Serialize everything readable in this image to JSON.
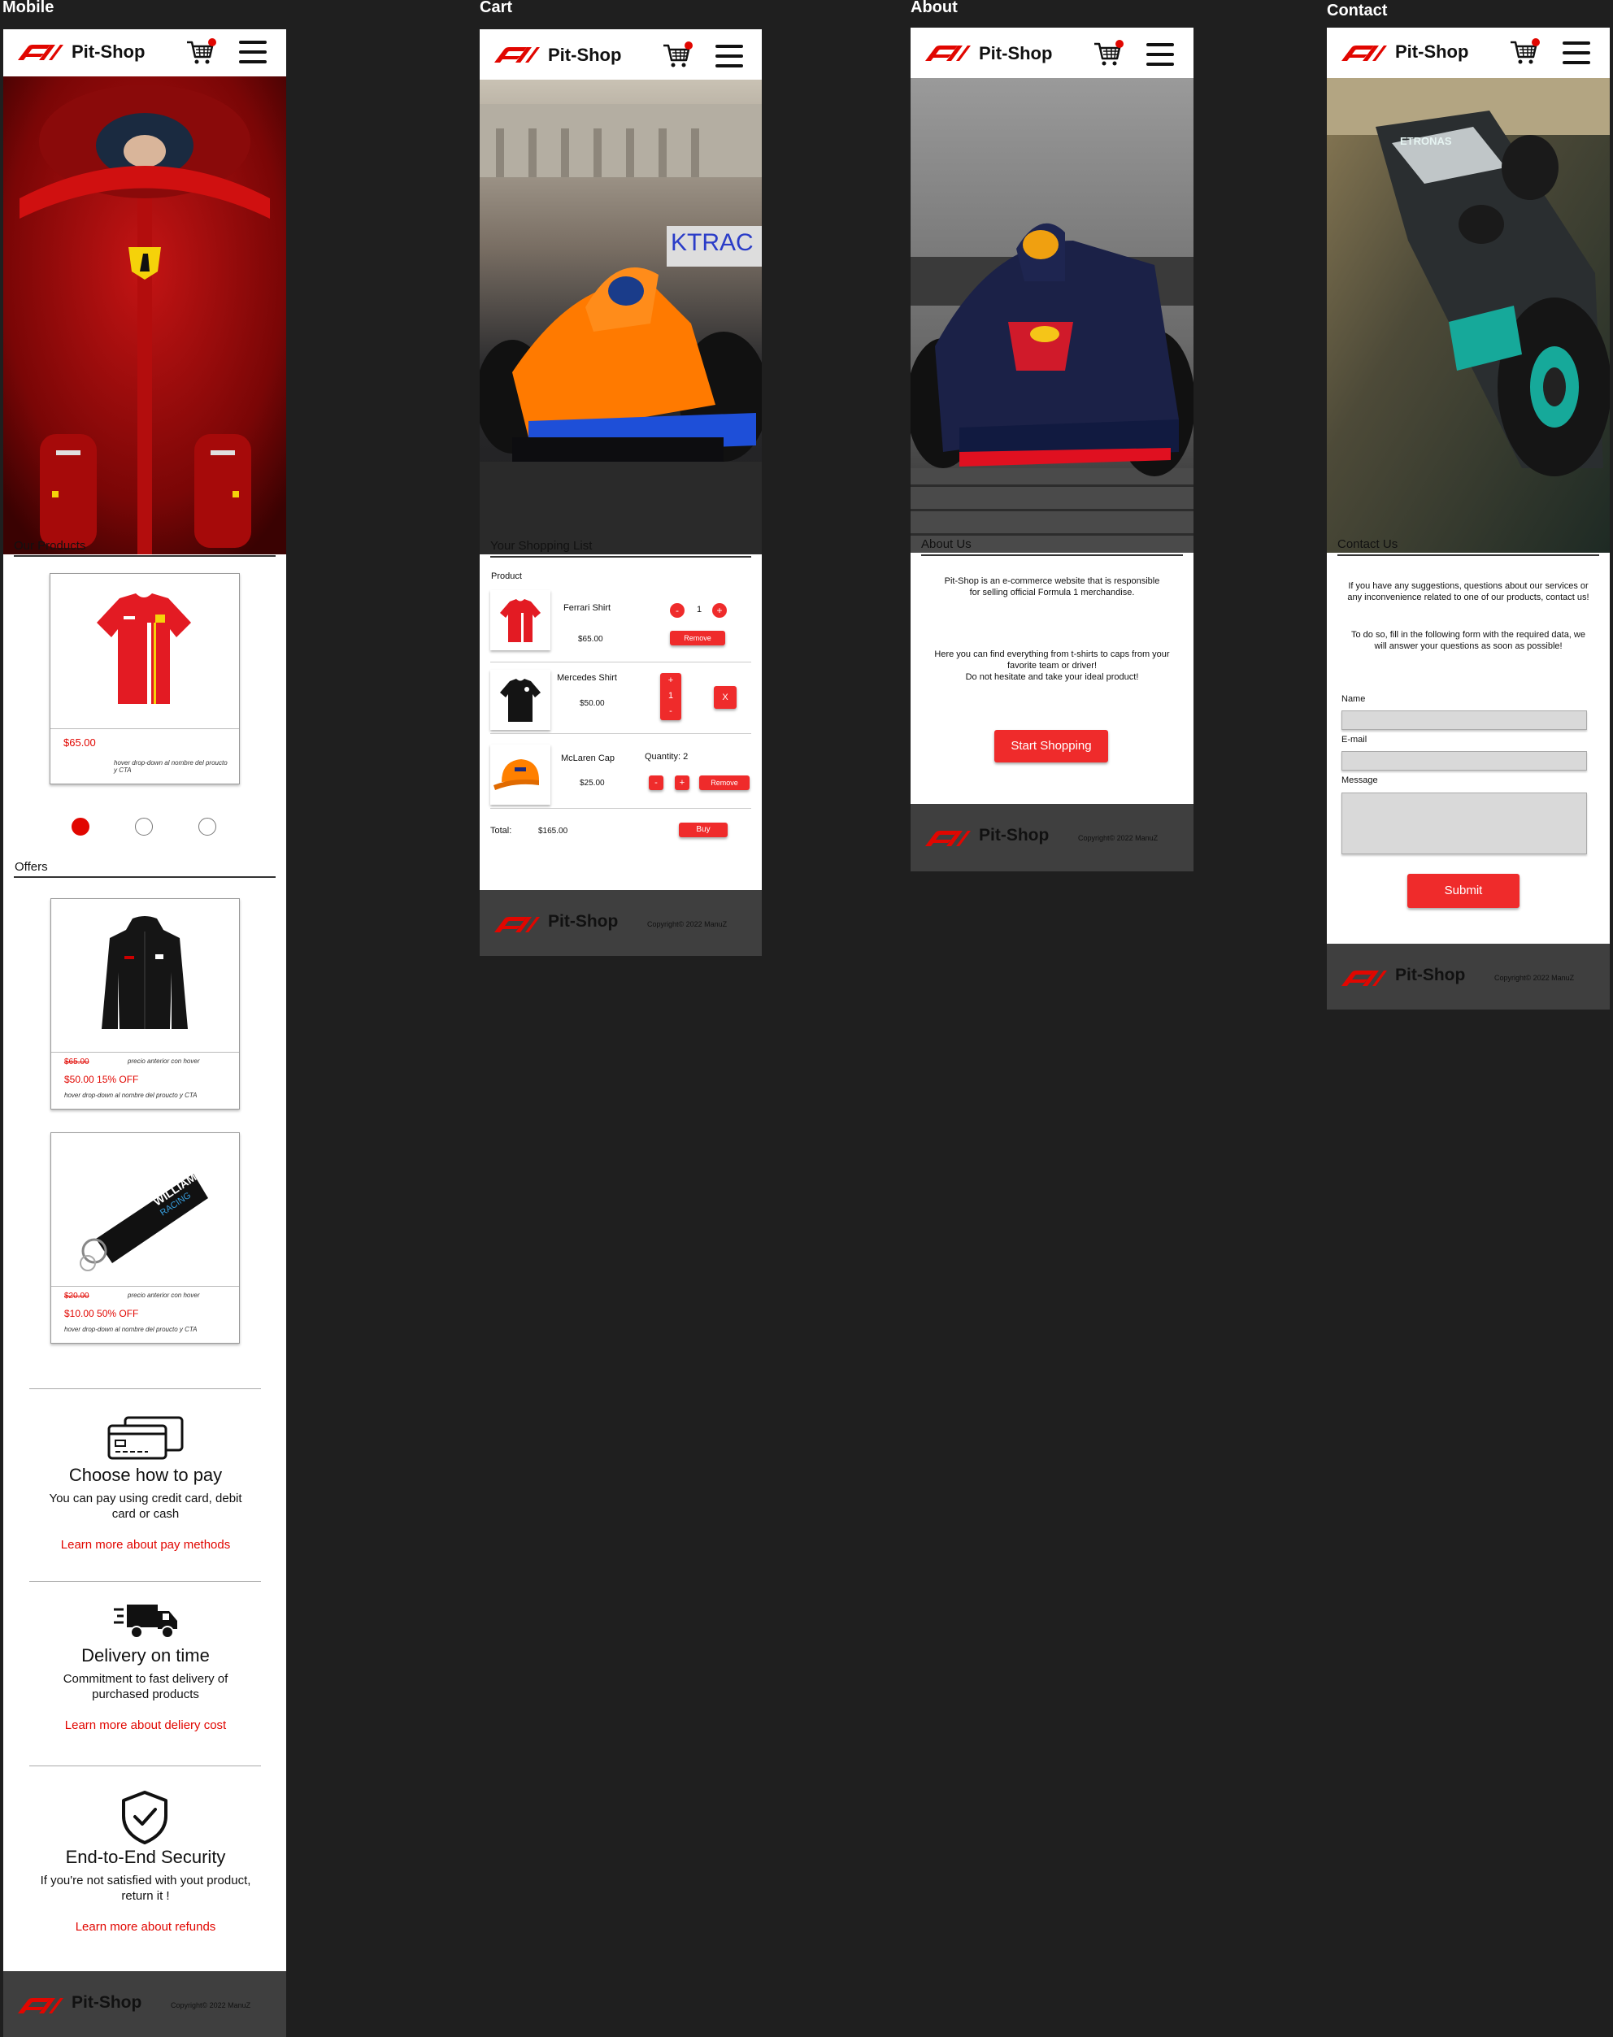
{
  "frames": {
    "mobile": "Mobile",
    "cart": "Cart",
    "about": "About",
    "contact": "Contact"
  },
  "brand": "Pit-Shop",
  "colors": {
    "accent": "#e10600",
    "button": "#ef2b2b",
    "footer": "#3f3f3f",
    "background": "#1f1f1f"
  },
  "icons": [
    "f1-logo-icon",
    "cart-icon",
    "hamburger-menu-icon",
    "credit-card-icon",
    "delivery-truck-icon",
    "shield-check-icon"
  ],
  "mobile": {
    "products_title": "Our Products",
    "product": {
      "price": "$65.00",
      "note": "hover drop-down al nombre del proucto y CTA"
    },
    "carousel_active": 1,
    "offers_title": "Offers",
    "offers": [
      {
        "old_price": "$65.00",
        "old_note": "precio anterior con hover",
        "new_price": "$50.00 15% OFF",
        "note": "hover drop-down al nombre del proucto y CTA"
      },
      {
        "old_price": "$20.00",
        "old_note": "precio anterior con hover",
        "new_price": "$10.00 50% OFF",
        "note": "hover drop-down al nombre del proucto y CTA"
      }
    ],
    "features": [
      {
        "title": "Choose how to pay",
        "text": "You can pay using credit card, debit card or cash",
        "link": "Learn more about pay methods"
      },
      {
        "title": "Delivery on time",
        "text": "Commitment to fast delivery of purchased products",
        "link": "Learn more about deliery cost"
      },
      {
        "title": "End-to-End Security",
        "text": "If you're not satisfied with yout product, return it !",
        "link": "Learn more about refunds"
      }
    ]
  },
  "cart": {
    "title": "Your Shopping List",
    "product_header": "Product",
    "items": [
      {
        "name": "Ferrari Shirt",
        "price": "$65.00",
        "qty": "1",
        "minus": "-",
        "plus": "+",
        "remove": "Remove"
      },
      {
        "name": "Mercedes Shirt",
        "price": "$50.00",
        "qty": "1",
        "minus": "-",
        "plus": "+",
        "remove": "X"
      },
      {
        "name": "McLaren Cap",
        "price": "$25.00",
        "qty_label": "Quantity: 2",
        "minus": "-",
        "plus": "+",
        "remove": "Remove"
      }
    ],
    "total_label": "Total:",
    "total_value": "$165.00",
    "buy": "Buy"
  },
  "about": {
    "title": "About Us",
    "p1": "Pit-Shop is an e-commerce website that is responsible for selling official Formula 1 merchandise.",
    "p2": "Here you can find everything from t-shirts to caps from your favorite team or driver!",
    "p3": "Do not hesitate and take your ideal product!",
    "cta": "Start Shopping"
  },
  "contact": {
    "title": "Contact Us",
    "p1": "If you have any suggestions, questions about our services or any inconvenience related to one of our products, contact us!",
    "p2": "To do so, fill in the following form with the required data, we will answer your questions as soon as possible!",
    "name_label": "Name",
    "email_label": "E-mail",
    "message_label": "Message",
    "submit": "Submit"
  },
  "footer": {
    "copyright": "Copyright© 2022 ManuZ"
  }
}
